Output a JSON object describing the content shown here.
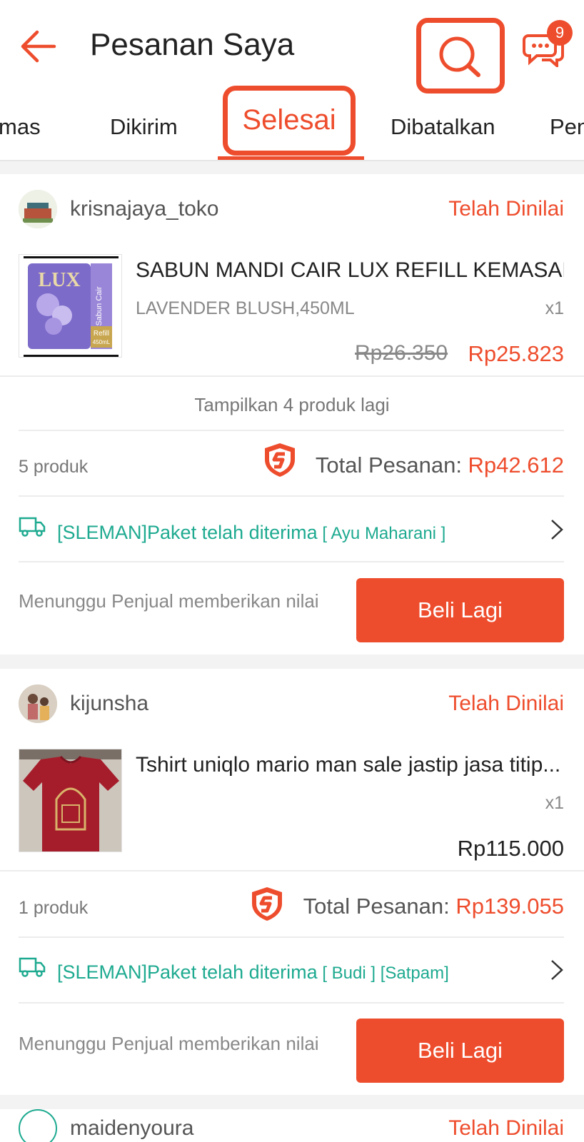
{
  "header": {
    "title": "Pesanan Saya",
    "chat_badge": "9"
  },
  "tabs": [
    {
      "label": "mas"
    },
    {
      "label": "Dikirim"
    },
    {
      "label": "Selesai",
      "selected": true
    },
    {
      "label": "Dibatalkan"
    },
    {
      "label": "Pen"
    }
  ],
  "orders": [
    {
      "shop_name": "krisnajaya_toko",
      "status": "Telah Dinilai",
      "product_name": "SABUN MANDI CAIR LUX REFILL KEMASAN...",
      "variation": "LAVENDER BLUSH,450ML",
      "qty": "x1",
      "price_original": "Rp26.350",
      "price": "Rp25.823",
      "show_more": "Tampilkan 4 produk lagi",
      "item_count": "5 produk",
      "total_label": "Total Pesanan: ",
      "total_value": "Rp42.612",
      "shipping_main": "[SLEMAN]Paket telah diterima",
      "shipping_detail": " [ Ayu Maharani ]",
      "wait_text": "Menunggu Penjual memberikan nilai",
      "button_label": "Beli Lagi",
      "thumb_brand": "LUX",
      "thumb_side": "Sabun Cair",
      "thumb_refill": "Refill",
      "thumb_size": "450mL"
    },
    {
      "shop_name": "kijunsha",
      "status": "Telah Dinilai",
      "product_name": "Tshirt uniqlo mario man sale jastip jasa titip...",
      "qty": "x1",
      "price": "Rp115.000",
      "item_count": "1 produk",
      "total_label": "Total Pesanan: ",
      "total_value": "Rp139.055",
      "shipping_main": "[SLEMAN]Paket telah diterima",
      "shipping_detail": " [ Budi ] [Satpam]",
      "wait_text": "Menunggu Penjual memberikan nilai",
      "button_label": "Beli Lagi"
    },
    {
      "shop_name": "maidenyoura",
      "status": "Telah Dinilai"
    }
  ],
  "colors": {
    "accent": "#ee4d2d",
    "shipping": "#1eaa90"
  }
}
